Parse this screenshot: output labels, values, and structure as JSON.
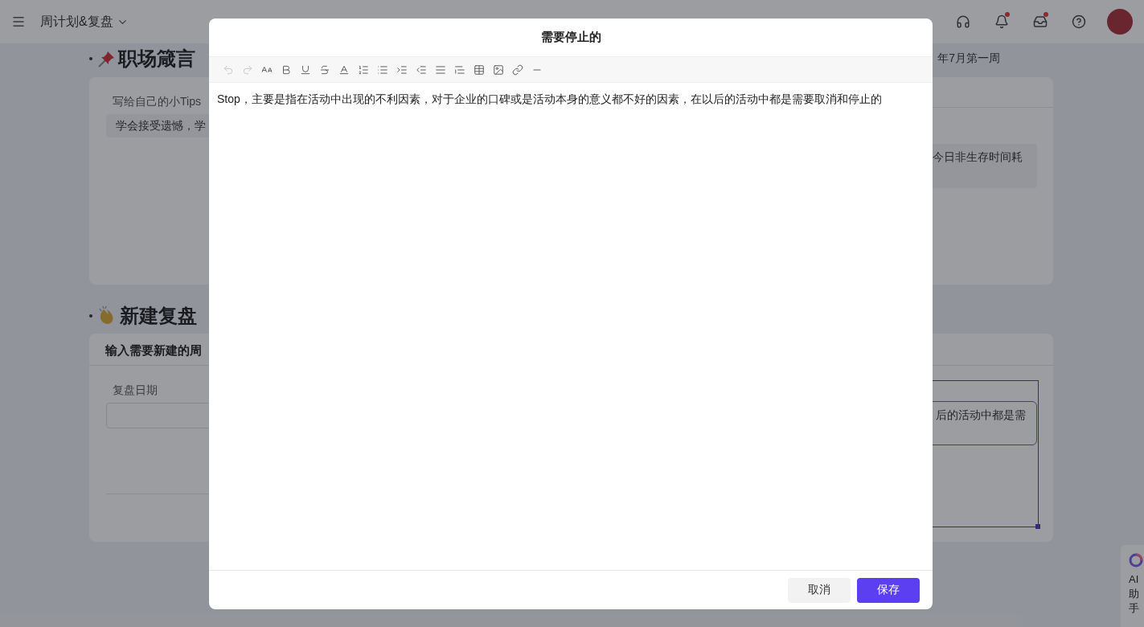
{
  "app_bar": {
    "title": "周计划&复盘",
    "icons": [
      {
        "kind": "headset",
        "badge": false
      },
      {
        "kind": "bell",
        "badge": true
      },
      {
        "kind": "inbox",
        "badge": true
      },
      {
        "kind": "help",
        "badge": false
      }
    ]
  },
  "sections": [
    {
      "kind": "quotes",
      "heading": "职场箴言",
      "date": "年7月第一周",
      "label": "写给自己的小Tips",
      "value": "学会接受遗憾，学",
      "side_value": "今日非生存时间耗"
    },
    {
      "kind": "review",
      "heading": "新建复盘",
      "card_title": "输入需要新建的周",
      "label": "复盘日期",
      "side_value": "后的活动中都是需"
    }
  ],
  "dialog": {
    "title": "需要停止的",
    "toolbar": [
      {
        "kind": "undo",
        "disabled": true
      },
      {
        "kind": "redo",
        "disabled": true
      },
      {
        "kind": "font-size",
        "disabled": false
      },
      {
        "kind": "bold",
        "disabled": false
      },
      {
        "kind": "underline",
        "disabled": false
      },
      {
        "kind": "strike",
        "disabled": false
      },
      {
        "kind": "color",
        "disabled": false
      },
      {
        "kind": "ordered-list",
        "disabled": false
      },
      {
        "kind": "bullet-list",
        "disabled": false
      },
      {
        "kind": "indent",
        "disabled": false
      },
      {
        "kind": "outdent",
        "disabled": false
      },
      {
        "kind": "align",
        "disabled": false
      },
      {
        "kind": "quote",
        "disabled": false
      },
      {
        "kind": "table",
        "disabled": false
      },
      {
        "kind": "image",
        "disabled": false
      },
      {
        "kind": "link",
        "disabled": false
      },
      {
        "kind": "rule",
        "disabled": false
      }
    ],
    "content": "Stop，主要是指在活动中出现的不利因素，对于企业的口碑或是活动本身的意义都不好的因素，在以后的活动中都是需要取消和停止的",
    "buttons": [
      {
        "label": "取消",
        "kind": "secondary"
      },
      {
        "label": "保存",
        "kind": "primary"
      }
    ]
  },
  "assistant": {
    "label": "AI助手"
  }
}
